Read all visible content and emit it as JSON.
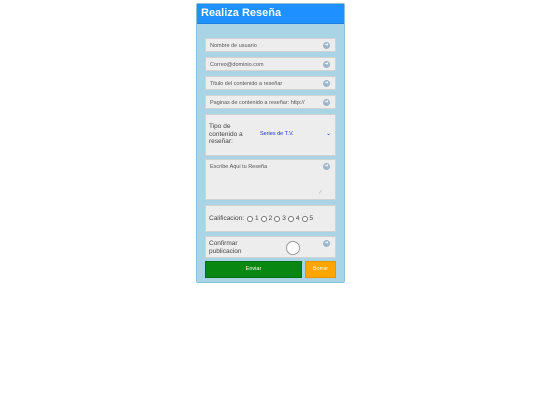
{
  "form": {
    "title": "Realiza Reseña",
    "username_placeholder": "Nombre de usuario",
    "email_placeholder": "Correo@dominio.com",
    "content_title_placeholder": "Titulo del contenido a reseñar",
    "pages_placeholder": "Paginas de contenido a reseñar: http://",
    "type_label": "Tipo de contenido a reseñar:",
    "type_selected": "Series de T.V.",
    "review_placeholder": "Escribe Aqui tu Reseña",
    "rating_label": "Calificacion:",
    "rating_options": [
      "1",
      "2",
      "3",
      "4",
      "5"
    ],
    "confirm_label": "Confirmar publicacion",
    "submit_label": "Enviar",
    "reset_label": "Borrar"
  },
  "icons": {
    "field_icon": "arrow-circle-icon",
    "select_icon": "chevron-down-icon",
    "resize_icon": "resize-grip-icon"
  },
  "colors": {
    "header": "#1e90ff",
    "panel": "#a9d4e6",
    "field": "#ededed",
    "submit": "#098713",
    "reset": "#ffa500"
  }
}
